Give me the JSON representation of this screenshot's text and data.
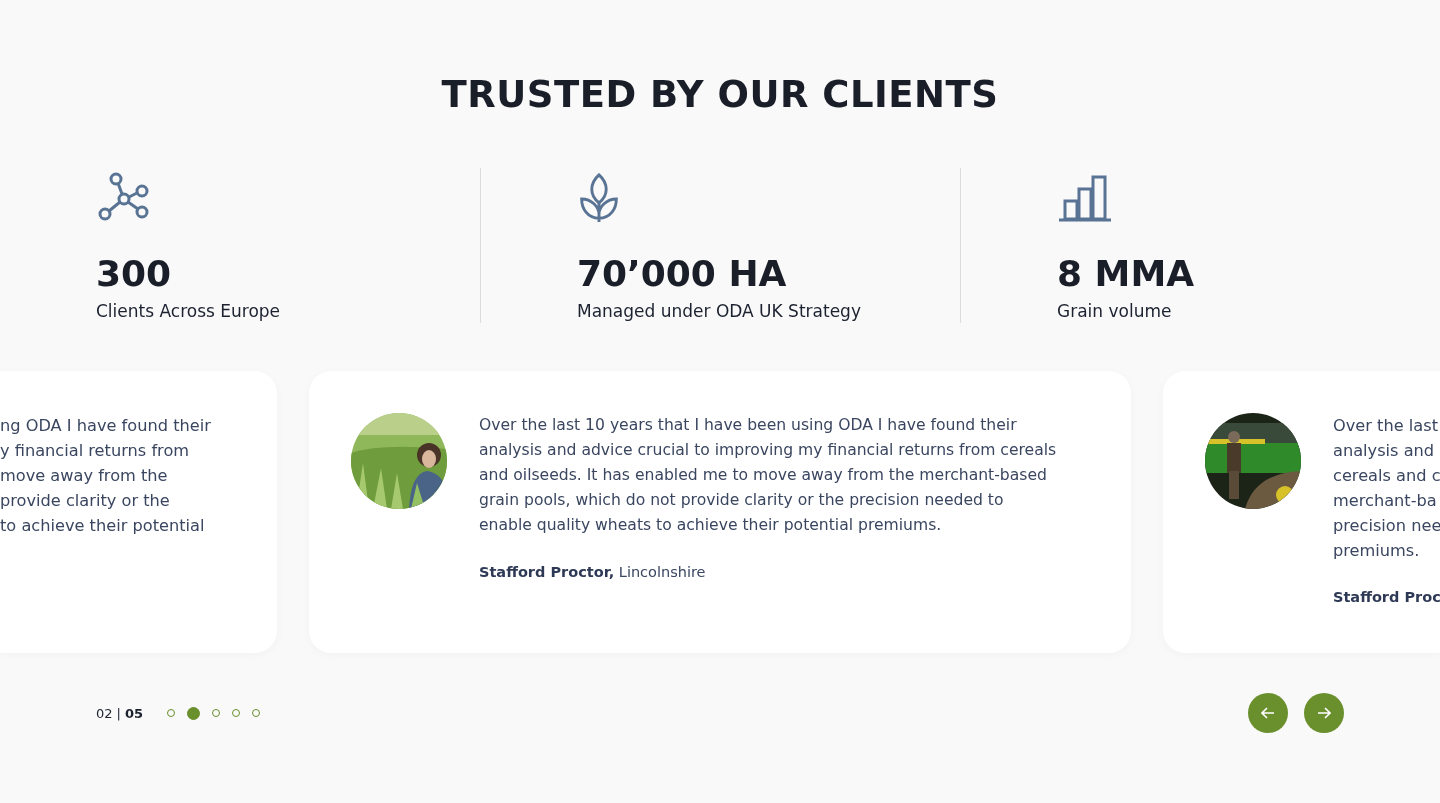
{
  "title": "TRUSTED BY OUR CLIENTS",
  "stats": [
    {
      "kind": "network",
      "value": "300",
      "label": "Clients Across Europe"
    },
    {
      "kind": "leaf",
      "value": "70’000 HA",
      "label": "Managed under ODA UK Strategy"
    },
    {
      "kind": "bars",
      "value": "8 MMA",
      "label": "Grain volume"
    }
  ],
  "testimonials": [
    {
      "kind": "clipped-left",
      "lines": [
        "ng ODA I have found their",
        "y financial returns from",
        "move away from the",
        "provide clarity or the",
        "to achieve their potential"
      ]
    },
    {
      "kind": "full",
      "lines": [
        "Over the last 10 years that I have been using ODA I have found their analysis and advice crucial to improving my financial returns from cereals and oilseeds. It has enabled me to move away from the merchant-based grain pools, which do not provide clarity or the precision needed to enable quality wheats to achieve their potential premiums."
      ],
      "author": "Stafford Proctor,",
      "location": "Lincolnshire"
    },
    {
      "kind": "clipped-right",
      "lines": [
        "Over the last",
        "analysis and",
        "cereals and c",
        "merchant-ba",
        "precision nee",
        "premiums."
      ],
      "author": "Stafford Proc"
    }
  ],
  "pager": {
    "current": "02",
    "separator": "|",
    "total": "05",
    "dots": [
      {
        "selected": false
      },
      {
        "selected": true
      },
      {
        "selected": false
      },
      {
        "selected": false
      },
      {
        "selected": false
      }
    ]
  },
  "buttons": [
    {
      "kind": "prev"
    },
    {
      "kind": "next"
    }
  ]
}
